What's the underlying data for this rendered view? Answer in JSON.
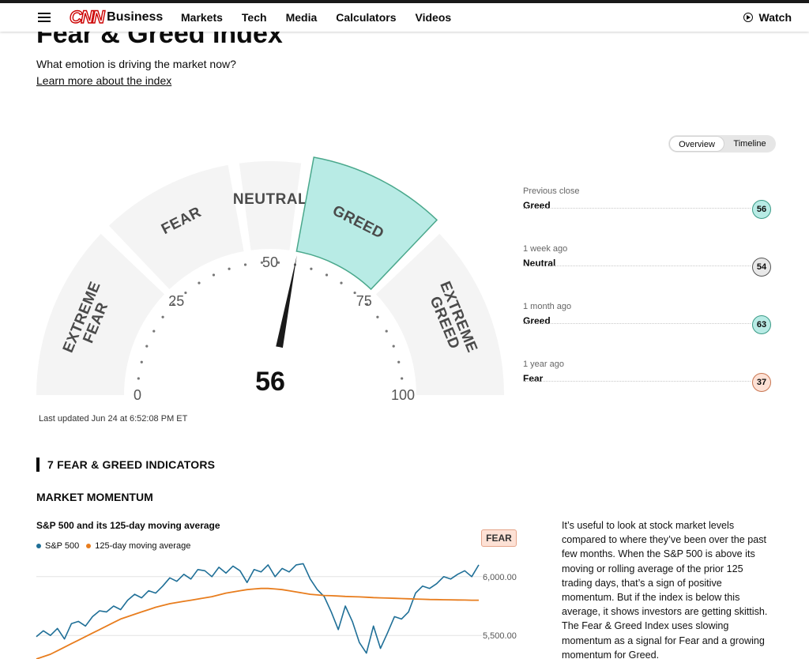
{
  "nav": {
    "brand": "CNN",
    "section": "Business",
    "links": [
      "Markets",
      "Tech",
      "Media",
      "Calculators",
      "Videos"
    ],
    "watch_label": "Watch"
  },
  "page": {
    "title": "Fear & Greed Index",
    "question": "What emotion is driving the market now?",
    "learn_more": "Learn more about the index",
    "last_updated": "Last updated Jun 24 at 6:52:08 PM ET"
  },
  "toggle": {
    "overview": "Overview",
    "timeline": "Timeline",
    "selected": "Overview"
  },
  "gauge": {
    "value": 56,
    "value_label": "56",
    "active_segment": "GREED",
    "segments": [
      {
        "label1": "EXTREME",
        "label2": "FEAR",
        "from": 0,
        "to": 25
      },
      {
        "label1": "FEAR",
        "label2": "",
        "from": 25,
        "to": 45
      },
      {
        "label1": "NEUTRAL",
        "label2": "",
        "from": 45,
        "to": 55
      },
      {
        "label1": "GREED",
        "label2": "",
        "from": 55,
        "to": 75
      },
      {
        "label1": "EXTREME",
        "label2": "GREED",
        "from": 75,
        "to": 100
      }
    ],
    "scale": [
      "0",
      "25",
      "50",
      "75",
      "100"
    ],
    "colors": {
      "segment": "#f4f4f4",
      "active": "#b8ebe5",
      "active_border": "#4aa88c",
      "needle": "#1a1a1a"
    }
  },
  "history": [
    {
      "label": "Previous close",
      "rating": "Greed",
      "value": "56",
      "bg": "#b8ebe5",
      "border": "#3a9a86"
    },
    {
      "label": "1 week ago",
      "rating": "Neutral",
      "value": "54",
      "bg": "#e8e8e8",
      "border": "#555555"
    },
    {
      "label": "1 month ago",
      "rating": "Greed",
      "value": "63",
      "bg": "#b8ebe5",
      "border": "#3a9a86"
    },
    {
      "label": "1 year ago",
      "rating": "Fear",
      "value": "37",
      "bg": "#fde1d5",
      "border": "#c87550"
    }
  ],
  "indicators": {
    "heading": "7 FEAR & GREED INDICATORS",
    "momentum": {
      "title": "MARKET MOMENTUM",
      "chart_title": "S&P 500 and its 125-day moving average",
      "legend": [
        {
          "name": "S&P 500",
          "color": "#1f6f97"
        },
        {
          "name": "125-day moving average",
          "color": "#e87d1e"
        }
      ],
      "badge": "FEAR",
      "description": "It’s useful to look at stock market levels compared to where they’ve been over the past few months. When the S&P 500 is above its moving or rolling average of the prior 125 trading days, that’s a sign of positive momentum. But if the index is below this average, it shows investors are getting skittish. The Fear & Greed Index uses slowing momentum as a signal for Fear and a growing momentum for Greed."
    }
  },
  "chart_data": {
    "type": "line",
    "title": "S&P 500 and its 125-day moving average",
    "y_ticks": [
      "6,000.00",
      "5,500.00"
    ],
    "ylim": [
      5300,
      6200
    ],
    "grid": true,
    "legend_position": "top-left",
    "series": [
      {
        "name": "S&P 500",
        "values": [
          5490,
          5540,
          5500,
          5560,
          5470,
          5600,
          5620,
          5580,
          5660,
          5710,
          5700,
          5750,
          5720,
          5800,
          5850,
          5820,
          5880,
          5860,
          5920,
          5990,
          5960,
          6020,
          5980,
          6060,
          6050,
          6000,
          6080,
          6030,
          6090,
          6050,
          5950,
          6060,
          6040,
          6100,
          6000,
          6070,
          6040,
          6100,
          6110,
          5980,
          5890,
          5830,
          5700,
          5550,
          5750,
          5620,
          5440,
          5350,
          5580,
          5390,
          5520,
          5660,
          5640,
          5700,
          5860,
          5920,
          5900,
          5940,
          6000,
          5980,
          6020,
          6050,
          6000,
          6100
        ]
      },
      {
        "name": "125-day moving average",
        "values": [
          5300,
          5320,
          5340,
          5370,
          5400,
          5430,
          5460,
          5490,
          5520,
          5550,
          5580,
          5610,
          5640,
          5660,
          5680,
          5700,
          5720,
          5740,
          5755,
          5770,
          5780,
          5790,
          5800,
          5810,
          5820,
          5830,
          5845,
          5860,
          5870,
          5880,
          5890,
          5895,
          5900,
          5900,
          5895,
          5890,
          5880,
          5870,
          5860,
          5850,
          5845,
          5840,
          5838,
          5835,
          5832,
          5830,
          5828,
          5825,
          5822,
          5820,
          5818,
          5816,
          5814,
          5812,
          5810,
          5808,
          5806,
          5805,
          5804,
          5803,
          5802,
          5801,
          5800,
          5800
        ]
      }
    ]
  }
}
